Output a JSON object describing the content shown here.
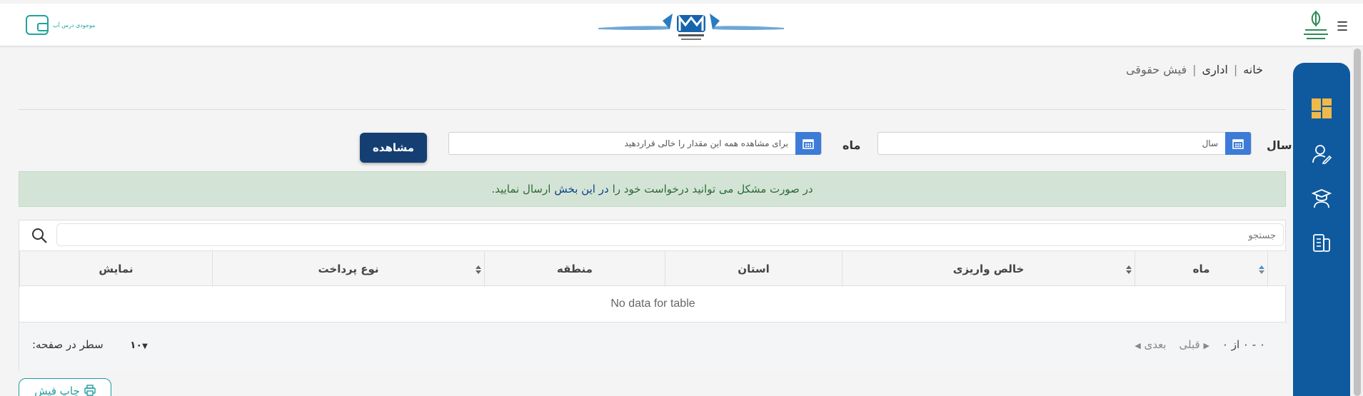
{
  "header": {
    "wallet_label": "موجودی درس آب",
    "menu_icon": "hamburger-icon"
  },
  "breadcrumb": {
    "home": "خانه",
    "section": "اداری",
    "current": "فیش حقوقی",
    "separator": "|"
  },
  "filters": {
    "year_label": "سال",
    "year_placeholder": "سال",
    "month_label": "ماه",
    "month_placeholder": "برای مشاهده همه این مقدار را خالی قراردهید",
    "view_button": "مشاهده"
  },
  "alert": {
    "before": "در صورت مشکل می توانید درخواست خود را",
    "link": "در این بخش",
    "after": "ارسال نمایید."
  },
  "table": {
    "search_placeholder": "جستجو",
    "columns": [
      "ماه",
      "خالص واریزی",
      "استان",
      "منطقه",
      "نوع پرداخت",
      "نمایش"
    ],
    "empty_text": "No data for table",
    "rows_per_page_label": "سطر در صفحه:",
    "rows_per_page_value": "۱۰",
    "pager_range": "۰ - ۰ از ۰",
    "prev_label": "قبلی",
    "next_label": "بعدی"
  },
  "print_button": "چاپ فیش",
  "colors": {
    "sidebar": "#0f5a9e",
    "primary_button": "#153f73",
    "calendar_button": "#3d7bd8",
    "alert_bg": "#d3e4d6",
    "teal": "#1d9ca0",
    "dashboard_icon": "#f0b94a"
  }
}
